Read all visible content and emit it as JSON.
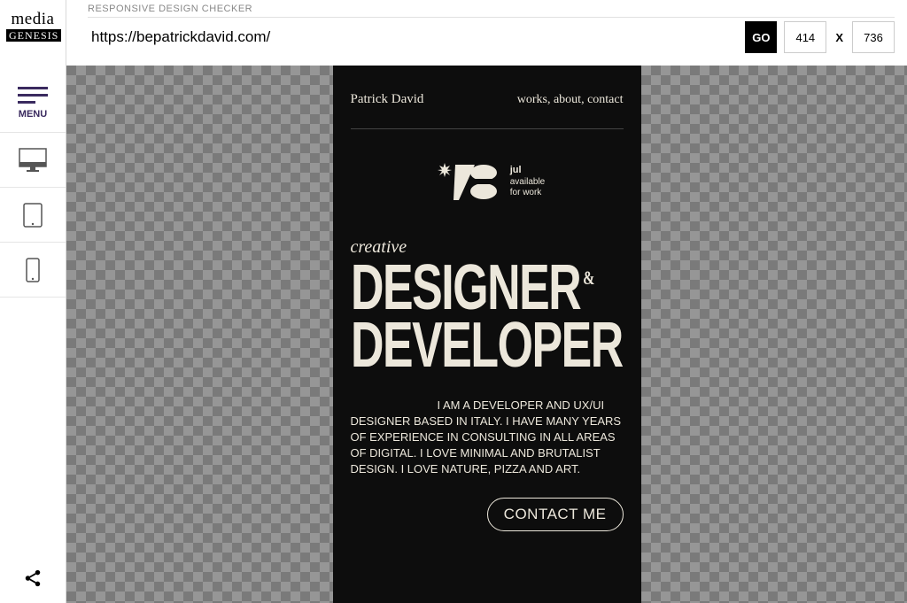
{
  "app": {
    "title": "RESPONSIVE DESIGN CHECKER",
    "logo_top": "media",
    "logo_bottom": "GENESIS",
    "menu_label": "MENU"
  },
  "url_bar": {
    "value": "https://bepatrickdavid.com/",
    "go_label": "GO",
    "width_value": "414",
    "separator": "X",
    "height_value": "736"
  },
  "site": {
    "brand": "Patrick David",
    "nav_works": "works,",
    "nav_about": "about,",
    "nav_contact": "contact",
    "avail_month": "jul",
    "avail_line1": "available",
    "avail_line2": "for work",
    "hero_sup": "creative",
    "hero_line1": "DESIGNER",
    "hero_amp": "&",
    "hero_line2": "DEVELOPER",
    "intro": "I AM A DEVELOPER AND UX/UI DESIGNER BASED IN ITALY. I HAVE MANY YEARS OF EXPERIENCE IN CONSULTING IN ALL AREAS OF DIGITAL. I LOVE MINIMAL AND BRUTALIST DESIGN. I LOVE NATURE, PIZZA AND ART.",
    "contact_label": "CONTACT ME"
  }
}
